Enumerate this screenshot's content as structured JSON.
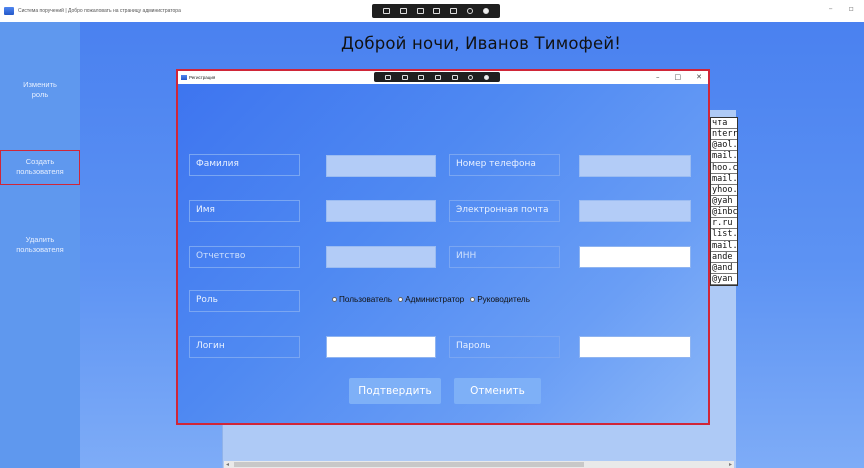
{
  "window": {
    "title": "Система поручений | Добро пожаловать на страницу администратора"
  },
  "header": {
    "greeting": "Доброй ночи, Иванов Тимофей!"
  },
  "sidebar": {
    "items": [
      {
        "label_line1": "Изменить",
        "label_line2": "роль",
        "active": false
      },
      {
        "label_line1": "Создать",
        "label_line2": "пользователя",
        "active": true
      },
      {
        "label_line1": "Удалить",
        "label_line2": "пользователя",
        "active": false
      }
    ]
  },
  "background_table": {
    "email_column": [
      "чта",
      "nterr",
      "@aol.c",
      "mail.",
      "hoo.c",
      "mail.c",
      "yhoo.",
      "@yah",
      "@inbc",
      "r.ru",
      "list.r",
      "mail.",
      "ande",
      "@and",
      "@yan"
    ]
  },
  "dialog": {
    "title": "Регистрация",
    "fields": {
      "surname_label": "Фамилия",
      "name_label": "Имя",
      "patronymic_label": "Отчетство",
      "phone_label": "Номер телефона",
      "email_label": "Электронная почта",
      "inn_label": "ИНН",
      "role_label": "Роль",
      "login_label": "Логин",
      "password_label": "Пароль"
    },
    "roles": [
      "Пользователь",
      "Администратор",
      "Руководитель"
    ],
    "confirm_label": "Подтвердить",
    "cancel_label": "Отменить"
  },
  "colors": {
    "accent_red": "#d02638",
    "sidebar_blue": "#5f98ee",
    "dialog_blue": "#4f89f2"
  }
}
